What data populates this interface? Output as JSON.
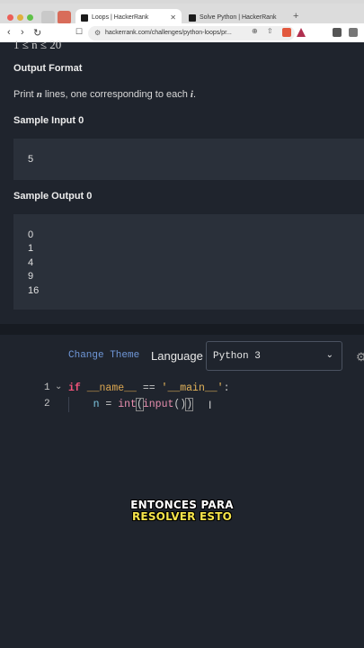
{
  "browser": {
    "tabs": [
      {
        "label": "Loops | HackerRank",
        "active": true
      },
      {
        "label": "Solve Python | HackerRank",
        "active": false
      }
    ],
    "new_tab": "+",
    "url": "hackerrank.com/challenges/python-loops/pr..."
  },
  "problem": {
    "cutoff_text": "1 ≤ n ≤ 20",
    "output_format_heading": "Output Format",
    "output_format_text_pre": "Print ",
    "output_format_var_n": "n",
    "output_format_text_mid": " lines, one corresponding to each ",
    "output_format_var_i": "i",
    "output_format_text_end": ".",
    "sample_input_heading": "Sample Input 0",
    "sample_input_value": "5",
    "sample_output_heading": "Sample Output 0",
    "sample_output_values": [
      "0",
      "1",
      "4",
      "9",
      "16"
    ]
  },
  "editor": {
    "change_theme": "Change Theme",
    "language_label": "Language",
    "language_value": "Python 3",
    "lines": [
      {
        "number": "1",
        "tokens": [
          "if",
          " ",
          "__name__",
          " == ",
          "'__main__'",
          ":"
        ]
      },
      {
        "number": "2",
        "tokens": [
          "    n",
          " = ",
          "int",
          "(",
          "input",
          "()",
          ")"
        ]
      }
    ]
  },
  "caption": {
    "line1": "ENTONCES PARA",
    "line2": "RESOLVER ESTO"
  },
  "colors": {
    "background": "#1f242d",
    "keyword": "#f2537a",
    "link": "#6f97d8",
    "caption_highlight": "#f5e44a"
  }
}
